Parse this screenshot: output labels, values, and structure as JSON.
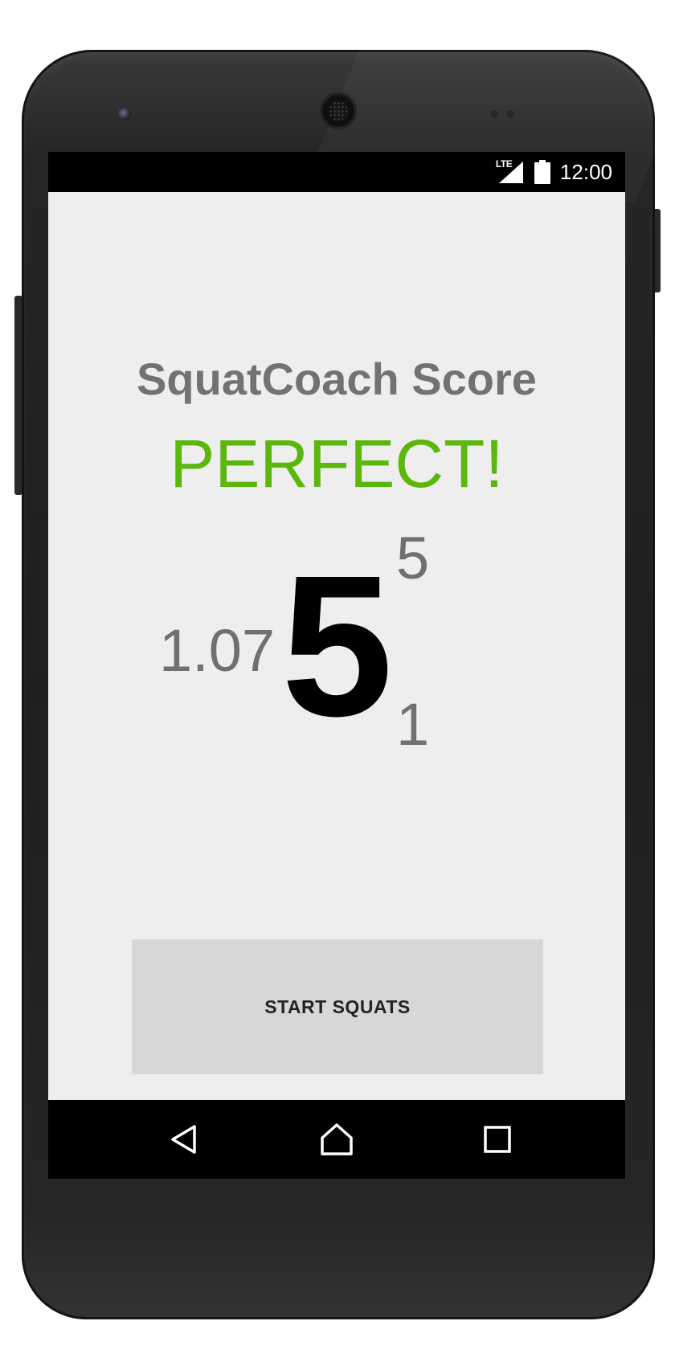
{
  "status_bar": {
    "network": "LTE",
    "time": "12:00",
    "icons": [
      "lte-signal-icon",
      "battery-icon"
    ]
  },
  "app": {
    "title": "SquatCoach Score",
    "verdict": "PERFECT!",
    "score": {
      "left": "1.07",
      "main": "5",
      "top": "5",
      "bottom": "1"
    },
    "start_button_label": "START SQUATS"
  },
  "nav_bar": {
    "icons": [
      "back-icon",
      "home-icon",
      "recents-icon"
    ]
  },
  "colors": {
    "verdict": "#5cb70c",
    "title": "#727272",
    "screen_background": "#eeeeee",
    "button_background": "#d6d7d7"
  }
}
